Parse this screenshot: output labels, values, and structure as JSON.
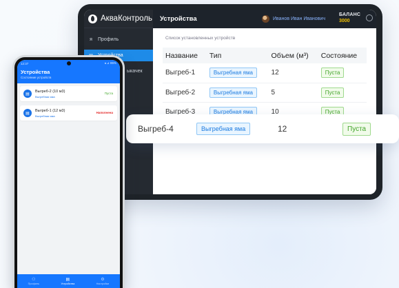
{
  "tablet": {
    "app_name": "АкваКонтроль",
    "nav": [
      {
        "label": "Профиль",
        "icon": "user-icon"
      },
      {
        "label": "Устройства",
        "icon": "device-icon"
      }
    ],
    "sidebar_partial_text": "ыкачек",
    "header": {
      "title": "Устройства",
      "user_name": "Иванов Иван Иванович",
      "balance_label": "БАЛАНС",
      "balance_value": "3000"
    },
    "subtitle": "Список установленных устройств",
    "columns": [
      "Название",
      "Тип",
      "Объем (м³)",
      "Состояние"
    ],
    "rows": [
      {
        "name": "Выгреб-1",
        "type": "Выгребная яма",
        "volume": "12",
        "status": "Пуста"
      },
      {
        "name": "Выгреб-2",
        "type": "Выгребная яма",
        "volume": "5",
        "status": "Пуста"
      },
      {
        "name": "Выгреб-3",
        "type": "Выгребная яма",
        "volume": "10",
        "status": "Пуста"
      }
    ]
  },
  "floating_row": {
    "name": "Выгреб-4",
    "type": "Выгребная яма",
    "volume": "12",
    "status": "Пуста"
  },
  "phone": {
    "status_time": "12:37",
    "status_right": "◂ ⊿ 85%",
    "title": "Устройства",
    "subtitle": "Состояние устройств",
    "devices": [
      {
        "name": "Выгреб-2 (10 м3)",
        "type": "Выгребная яма",
        "status": "Пуста",
        "status_kind": "ok"
      },
      {
        "name": "Выгреб-1 (12 м3)",
        "type": "Выгребная яма",
        "status": "Наполнена",
        "status_kind": "full"
      }
    ],
    "tabs": [
      {
        "label": "Профиль",
        "icon": "person-icon",
        "active": false
      },
      {
        "label": "Устройства",
        "icon": "device-icon",
        "active": true
      },
      {
        "label": "Настройки",
        "icon": "gear-icon",
        "active": false
      }
    ]
  },
  "colors": {
    "accent": "#1677ff",
    "status_ok": "#42a42a",
    "status_full": "#e32a2a"
  }
}
